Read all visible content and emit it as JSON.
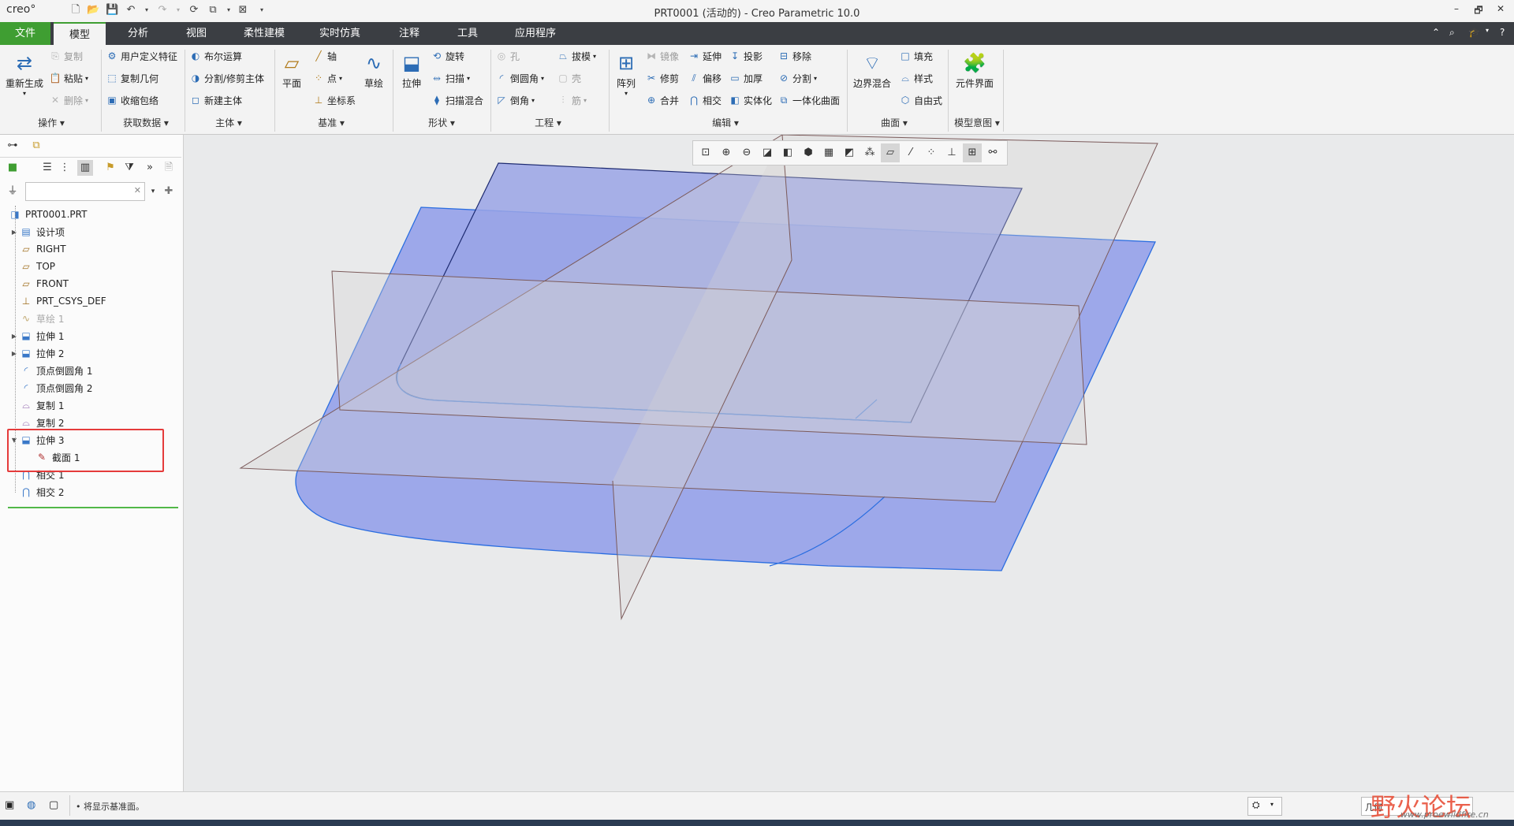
{
  "titlebar": {
    "logo": "creo°",
    "title": "PRT0001 (活动的) - Creo Parametric 10.0",
    "window_buttons": [
      "–",
      "🗗",
      "✕"
    ]
  },
  "tabs": {
    "file": "文件",
    "items": [
      "模型",
      "分析",
      "视图",
      "柔性建模",
      "实时仿真",
      "注释",
      "工具",
      "应用程序"
    ]
  },
  "ribbon": {
    "operations": {
      "regenerate": "重新生成",
      "copy": "复制",
      "paste": "粘贴",
      "delete": "删除",
      "group": "操作"
    },
    "get_data": {
      "udf": "用户定义特征",
      "copy_geom": "复制几何",
      "shrinkwrap": "收缩包络",
      "group": "获取数据"
    },
    "body": {
      "boolean": "布尔运算",
      "split": "分割/修剪主体",
      "new_body": "新建主体",
      "group": "主体"
    },
    "datum": {
      "plane": "平面",
      "axis": "轴",
      "point": "点",
      "csys": "坐标系",
      "sketch": "草绘",
      "group": "基准"
    },
    "shapes": {
      "extrude": "拉伸",
      "revolve": "旋转",
      "sweep": "扫描",
      "swept_blend": "扫描混合",
      "group": "形状"
    },
    "engineering": {
      "hole": "孔",
      "round": "倒圆角",
      "chamfer": "倒角",
      "draft": "拔模",
      "shell": "壳",
      "rib": "筋",
      "group": "工程"
    },
    "editing": {
      "pattern": "阵列",
      "mirror": "镜像",
      "trim": "修剪",
      "merge": "合并",
      "extend": "延伸",
      "offset": "偏移",
      "intersect": "相交",
      "project": "投影",
      "thicken": "加厚",
      "solidify": "实体化",
      "remove": "移除",
      "split": "分割",
      "unify": "一体化曲面",
      "group": "编辑"
    },
    "surfaces": {
      "boundary": "边界混合",
      "fill": "填充",
      "style": "样式",
      "freestyle": "自由式",
      "group": "曲面"
    },
    "model_intent": {
      "component_interface": "元件界面",
      "group": "模型意图"
    }
  },
  "tree": {
    "root": "PRT0001.PRT",
    "items": [
      {
        "label": "设计项",
        "icon": "design-items-icon"
      },
      {
        "label": "RIGHT",
        "icon": "datum-plane-icon"
      },
      {
        "label": "TOP",
        "icon": "datum-plane-icon"
      },
      {
        "label": "FRONT",
        "icon": "datum-plane-icon"
      },
      {
        "label": "PRT_CSYS_DEF",
        "icon": "csys-icon"
      },
      {
        "label": "草绘 1",
        "icon": "sketch-icon"
      },
      {
        "label": "拉伸 1",
        "icon": "extrude-icon"
      },
      {
        "label": "拉伸 2",
        "icon": "extrude-icon"
      },
      {
        "label": "顶点倒圆角 1",
        "icon": "vertex-round-icon"
      },
      {
        "label": "顶点倒圆角 2",
        "icon": "vertex-round-icon"
      },
      {
        "label": "复制 1",
        "icon": "copy-surface-icon"
      },
      {
        "label": "复制 2",
        "icon": "copy-surface-icon"
      },
      {
        "label": "拉伸 3",
        "icon": "extrude-icon"
      },
      {
        "label": "截面 1",
        "icon": "section-icon"
      },
      {
        "label": "相交 1",
        "icon": "intersect-icon"
      },
      {
        "label": "相交 2",
        "icon": "intersect-icon"
      }
    ]
  },
  "status": {
    "message": "• 将显示基准面。",
    "filter": "几何",
    "watermark_main": "野火论坛",
    "watermark_url": "www.proewildfire.cn"
  },
  "colors": {
    "accent_green": "#3f9e32",
    "tabbar": "#3b3e43",
    "surface_fill": "#8f9cea",
    "highlight_red": "#e53b3b"
  }
}
